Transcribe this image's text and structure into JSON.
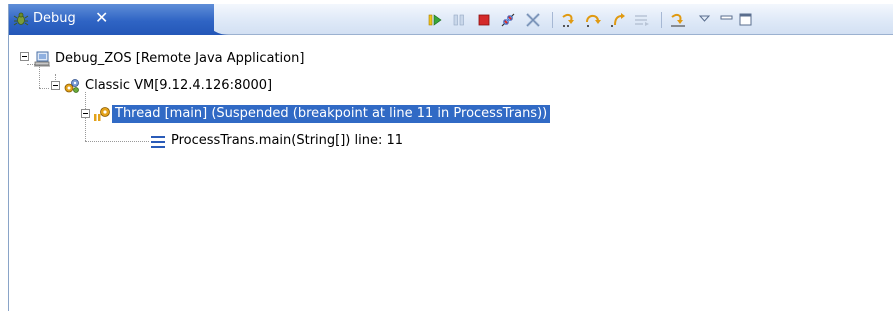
{
  "tab": {
    "label": "Debug",
    "close_glyph": "✕"
  },
  "toolbar": {
    "buttons": [
      {
        "name": "resume-icon"
      },
      {
        "name": "suspend-icon"
      },
      {
        "name": "terminate-icon"
      },
      {
        "name": "disconnect-icon"
      },
      {
        "name": "remove-terminated-icon"
      },
      {
        "name": "step-into-icon"
      },
      {
        "name": "step-over-icon"
      },
      {
        "name": "step-return-icon"
      },
      {
        "name": "drop-to-frame-icon"
      },
      {
        "name": "use-step-filters-icon"
      },
      {
        "name": "view-menu-icon"
      },
      {
        "name": "minimize-icon"
      },
      {
        "name": "maximize-icon"
      }
    ]
  },
  "tree": {
    "launch": "Debug_ZOS [Remote Java Application]",
    "vm": "Classic VM[9.12.4.126:8000]",
    "thread": "Thread [main] (Suspended (breakpoint at line 11 in ProcessTrans))",
    "frame": "ProcessTrans.main(String[]) line: 11"
  },
  "colors": {
    "selection": "#316ac5",
    "tab_active": "#2f64c4"
  }
}
